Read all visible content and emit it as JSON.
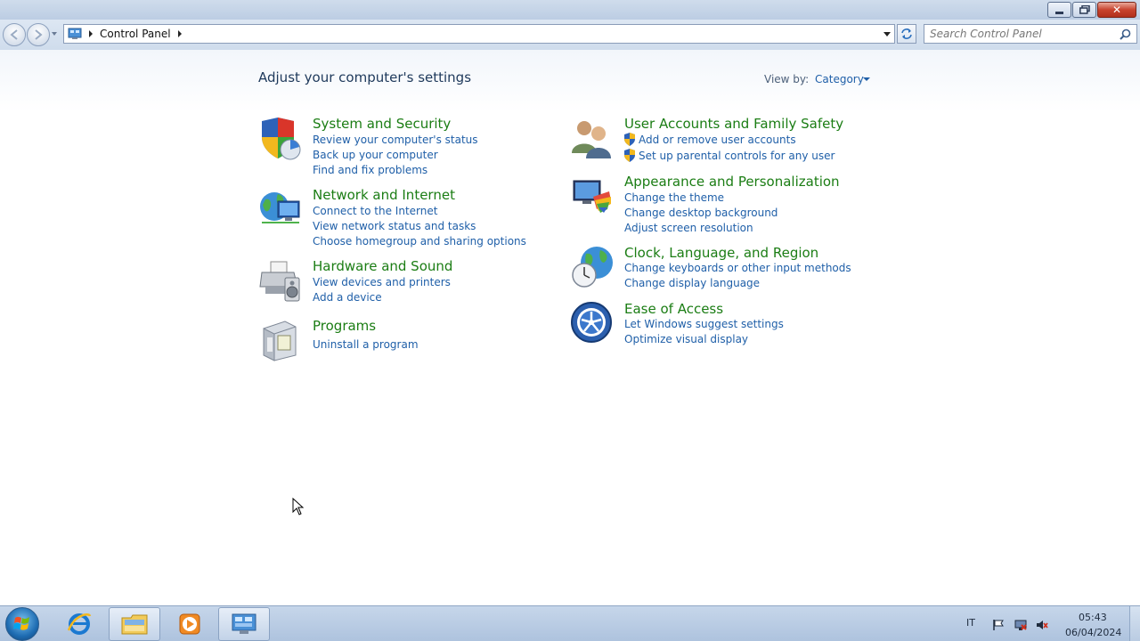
{
  "window": {
    "controls": {
      "minimize_icon": "minimize-icon",
      "maximize_icon": "restore-icon",
      "close_icon": "close-icon",
      "close_glyph": "✕"
    }
  },
  "address_bar": {
    "breadcrumb": [
      "Control Panel"
    ],
    "search_placeholder": "Search Control Panel"
  },
  "main": {
    "heading": "Adjust your computer's settings",
    "view_by_label": "View by:",
    "view_by_value": "Category",
    "left_categories": [
      {
        "title": "System and Security",
        "icon": "shield-icon",
        "links": [
          "Review your computer's status",
          "Back up your computer",
          "Find and fix problems"
        ]
      },
      {
        "title": "Network and Internet",
        "icon": "network-globe-icon",
        "links": [
          "Connect to the Internet",
          "View network status and tasks",
          "Choose homegroup and sharing options"
        ]
      },
      {
        "title": "Hardware and Sound",
        "icon": "printer-speaker-icon",
        "links": [
          "View devices and printers",
          "Add a device"
        ]
      },
      {
        "title": "Programs",
        "icon": "programs-box-icon",
        "links": [
          "Uninstall a program"
        ]
      }
    ],
    "right_categories": [
      {
        "title": "User Accounts and Family Safety",
        "icon": "users-icon",
        "links": [
          "Add or remove user accounts",
          "Set up parental controls for any user"
        ]
      },
      {
        "title": "Appearance and Personalization",
        "icon": "monitor-palette-icon",
        "links": [
          "Change the theme",
          "Change desktop background",
          "Adjust screen resolution"
        ]
      },
      {
        "title": "Clock, Language, and Region",
        "icon": "clock-globe-icon",
        "links": [
          "Change keyboards or other input methods",
          "Change display language"
        ]
      },
      {
        "title": "Ease of Access",
        "icon": "ease-of-access-icon",
        "links": [
          "Let Windows suggest settings",
          "Optimize visual display"
        ]
      }
    ]
  },
  "taskbar": {
    "pinned": [
      "start-orb-icon",
      "internet-explorer-icon",
      "file-explorer-icon",
      "media-player-icon",
      "control-panel-icon"
    ],
    "tray": {
      "language": "IT",
      "time": "05:43",
      "date": "06/04/2024"
    }
  },
  "colors": {
    "category_title": "#1b7d14",
    "link": "#1f5fa8",
    "heading": "#1e395b"
  }
}
